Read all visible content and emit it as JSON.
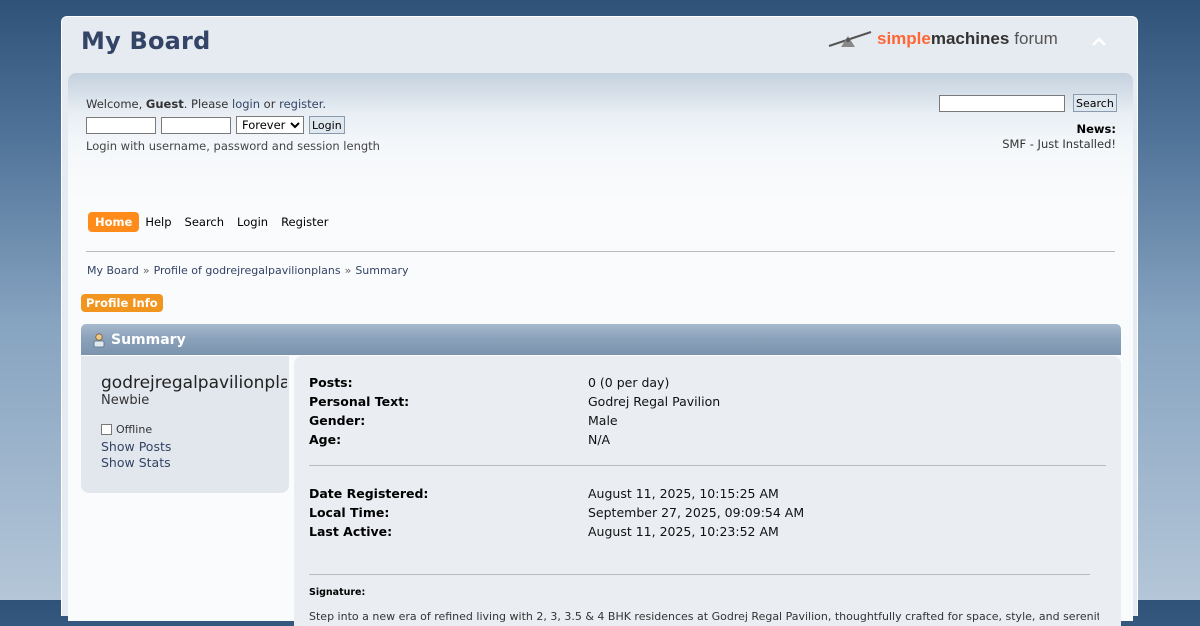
{
  "header": {
    "forum_title": "My Board",
    "logo": {
      "simple": "simple",
      "machines": "machines",
      "forum": "forum"
    },
    "upshrink_icon": "chevron-up-icon"
  },
  "userbar": {
    "welcome_prefix": "Welcome,",
    "guest": "Guest",
    "please": ". Please",
    "login_link": "login",
    "or": "or",
    "register_link": "register",
    "period": ".",
    "session_options": [
      "Forever"
    ],
    "session_selected": "Forever",
    "login_button": "Login",
    "login_help": "Login with username, password and session length",
    "search_button": "Search",
    "news_label": "News:",
    "news_text": "SMF - Just Installed!"
  },
  "menu": {
    "items": [
      {
        "label": "Home",
        "active": true
      },
      {
        "label": "Help"
      },
      {
        "label": "Search"
      },
      {
        "label": "Login"
      },
      {
        "label": "Register"
      }
    ]
  },
  "breadcrumb": {
    "items": [
      "My Board",
      "Profile of godrejregalpavilionplans",
      "Summary"
    ],
    "separator": "»"
  },
  "profile_tab": "Profile Info",
  "summary": {
    "title": "Summary",
    "username": "godrejregalpavilionplans",
    "position": "Newbie",
    "status": "Offline",
    "links": [
      "Show Posts",
      "Show Stats"
    ]
  },
  "details": {
    "group1": [
      {
        "label": "Posts:",
        "value": "0 (0 per day)"
      },
      {
        "label": "Personal Text:",
        "value": "Godrej Regal Pavilion"
      },
      {
        "label": "Gender:",
        "value": "Male"
      },
      {
        "label": "Age:",
        "value": "N/A"
      }
    ],
    "group2": [
      {
        "label": "Date Registered:",
        "value": "August 11, 2025, 10:15:25 AM"
      },
      {
        "label": "Local Time:",
        "value": "September 27, 2025, 09:09:54 AM"
      },
      {
        "label": "Last Active:",
        "value": "August 11, 2025, 10:23:52 AM"
      }
    ],
    "signature_label": "Signature:",
    "signature_text": "Step into a new era of refined living with 2, 3, 3.5 & 4 BHK residences at Godrej Regal Pavilion, thoughtfully crafted for space, style, and serenity."
  },
  "colors": {
    "accent": "#ff8c1a",
    "title": "#334466",
    "catbg": "#8aa1ba"
  }
}
